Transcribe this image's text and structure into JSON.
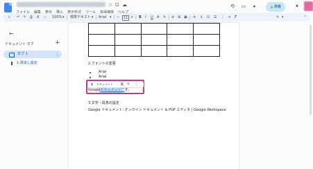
{
  "window": {
    "title": "ブログ用ドキュメント",
    "share_label": "共有"
  },
  "menu": [
    "ファイル",
    "編集",
    "表示",
    "挿入",
    "表示形式",
    "ツール",
    "拡張機能",
    "ヘルプ"
  ],
  "toolbar": {
    "zoom": "100%",
    "style": "標準テキスト",
    "font": "Arial",
    "font_size": "11",
    "minus": "−",
    "plus": "+"
  },
  "sidebar": {
    "back_icon": "arrow-left-icon",
    "heading": "ドキュメント タブ",
    "add_tab": "+",
    "tab_label": "タブ 1",
    "tab_more": "⋮",
    "outline_item": "1.見出し設定"
  },
  "document": {
    "section2_heading": "2.フォントの変更",
    "bullets": [
      "Arial",
      "Arial"
    ],
    "hover_card_text": "ドキュメント",
    "link_line_prefix": "Google",
    "link_line_link": "ドキュメントで",
    "link_line_suffix": "す。",
    "section3_heading": "3.文字・段落の設定",
    "link_title": "Google ドキュメント: オンライン ドキュメント & PDF エディタ | Google Workspace"
  }
}
